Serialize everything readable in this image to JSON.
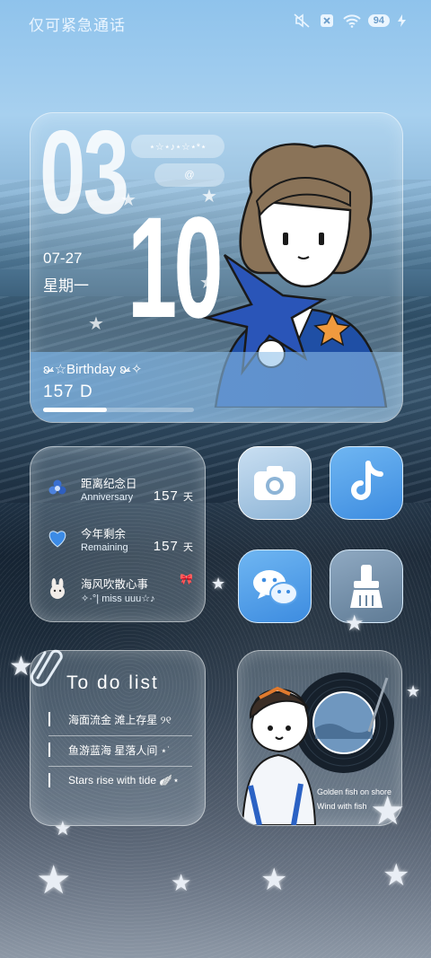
{
  "status_bar": {
    "emergency_text": "仅可紧急通话",
    "battery": "94",
    "icons": [
      "mute-icon",
      "no-sim-icon",
      "wifi-icon",
      "battery-icon",
      "charging-icon"
    ]
  },
  "date_widget": {
    "month": "03",
    "day": "10",
    "date": "07-27",
    "weekday": "星期一",
    "pill_1": "⋆☆⋆♪⋆☆⋆*⋆",
    "pill_2": "@",
    "birthday_title": "ʚ̴̶̷·☆Birthday ʚ̴̶̷·✧",
    "birthday_days": "157 D",
    "birthday_progress": 0.42
  },
  "anniversary_widget": {
    "items": [
      {
        "icon": "flower-icon",
        "title": "距离纪念日",
        "subtitle": "Anniversary",
        "value": "157",
        "unit": "天"
      },
      {
        "icon": "heart-icon",
        "title": "今年剩余",
        "subtitle": "Remaining",
        "value": "157",
        "unit": "天"
      },
      {
        "icon": "bunny-icon",
        "title": "海风吹散心事",
        "subtitle": "✧·°| miss uuu☆♪",
        "value": "",
        "unit": "🎀"
      }
    ]
  },
  "apps": [
    {
      "name": "camera",
      "icon": "camera-icon"
    },
    {
      "name": "tiktok",
      "icon": "tiktok-icon"
    },
    {
      "name": "wechat",
      "icon": "wechat-icon"
    },
    {
      "name": "cleaner",
      "icon": "broom-icon"
    }
  ],
  "todo_widget": {
    "title": "To do list",
    "items": [
      "海面流金 滩上存星 ୨୧",
      "鱼游蓝海 星落人间 ⋆˙",
      "Stars rise with tide 🪽⋆"
    ]
  },
  "photo_widget": {
    "line_1": "Golden fish on shore",
    "line_2": "Wind with fish"
  }
}
